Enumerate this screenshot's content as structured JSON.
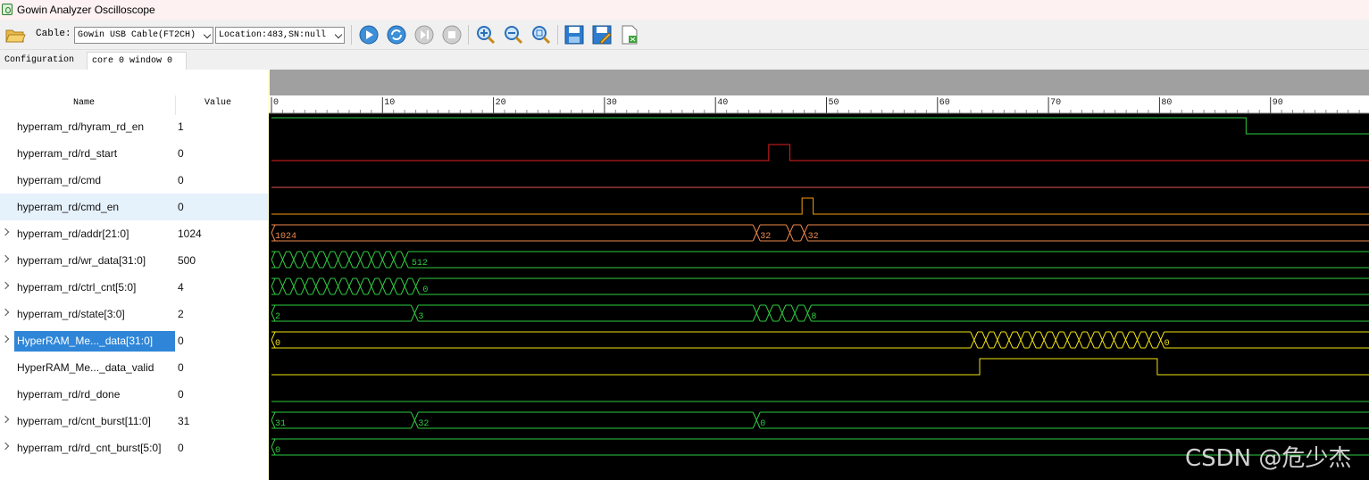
{
  "window": {
    "title": "Gowin Analyzer Oscilloscope"
  },
  "toolbar": {
    "cable_label": "Cable:",
    "cable_value": "Gowin USB Cable(FT2CH)",
    "location_value": "Location:483,SN:null",
    "buttons": [
      "open-folder",
      "run",
      "auto-run",
      "step",
      "stop",
      "zoom-in",
      "zoom-out",
      "zoom-fit",
      "save",
      "save-as",
      "export"
    ]
  },
  "tabs": [
    {
      "label": "Configuration",
      "active": false
    },
    {
      "label": "core 0 window 0",
      "active": true
    }
  ],
  "columns": {
    "name": "Name",
    "value": "Value"
  },
  "ruler": {
    "ticks": [
      "0",
      "10",
      "20",
      "30",
      "40",
      "50",
      "60",
      "70",
      "80",
      "90"
    ]
  },
  "signals": [
    {
      "name": "hyperram_rd/hyram_rd_en",
      "value": "1",
      "expandable": false,
      "color": "#2ecc40"
    },
    {
      "name": "hyperram_rd/rd_start",
      "value": "0",
      "expandable": false,
      "color": "#e02020"
    },
    {
      "name": "hyperram_rd/cmd",
      "value": "0",
      "expandable": false,
      "color": "#e05050"
    },
    {
      "name": "hyperram_rd/cmd_en",
      "value": "0",
      "expandable": false,
      "color": "#f39c12"
    },
    {
      "name": "hyperram_rd/addr[21:0]",
      "value": "1024",
      "expandable": true,
      "color": "#f08a4b"
    },
    {
      "name": "hyperram_rd/wr_data[31:0]",
      "value": "500",
      "expandable": true,
      "color": "#2ecc40"
    },
    {
      "name": "hyperram_rd/ctrl_cnt[5:0]",
      "value": "4",
      "expandable": true,
      "color": "#2ecc40"
    },
    {
      "name": "hyperram_rd/state[3:0]",
      "value": "2",
      "expandable": true,
      "color": "#2ecc40"
    },
    {
      "name": "HyperRAM_Me..._data[31:0]",
      "value": "0",
      "expandable": true,
      "color": "#f1e40f",
      "selected": true
    },
    {
      "name": "HyperRAM_Me..._data_valid",
      "value": "0",
      "expandable": false,
      "color": "#f1e40f"
    },
    {
      "name": "hyperram_rd/rd_done",
      "value": "0",
      "expandable": false,
      "color": "#2ecc40"
    },
    {
      "name": "hyperram_rd/cnt_burst[11:0]",
      "value": "31",
      "expandable": true,
      "color": "#2ecc40"
    },
    {
      "name": "hyperram_rd/rd_cnt_burst[5:0]",
      "value": "0",
      "expandable": true,
      "color": "#2ecc40"
    }
  ],
  "bus_labels": {
    "addr": [
      "1024",
      "32",
      "32"
    ],
    "wr_data": [
      "512"
    ],
    "ctrl_cnt": [
      "0"
    ],
    "state": [
      "2",
      "3",
      "8"
    ],
    "ram_data": [
      "0",
      "0"
    ],
    "cnt_burst": [
      "31",
      "32",
      "0"
    ],
    "rd_cnt_burst": [
      "0"
    ]
  },
  "watermark": "CSDN @危少杰"
}
